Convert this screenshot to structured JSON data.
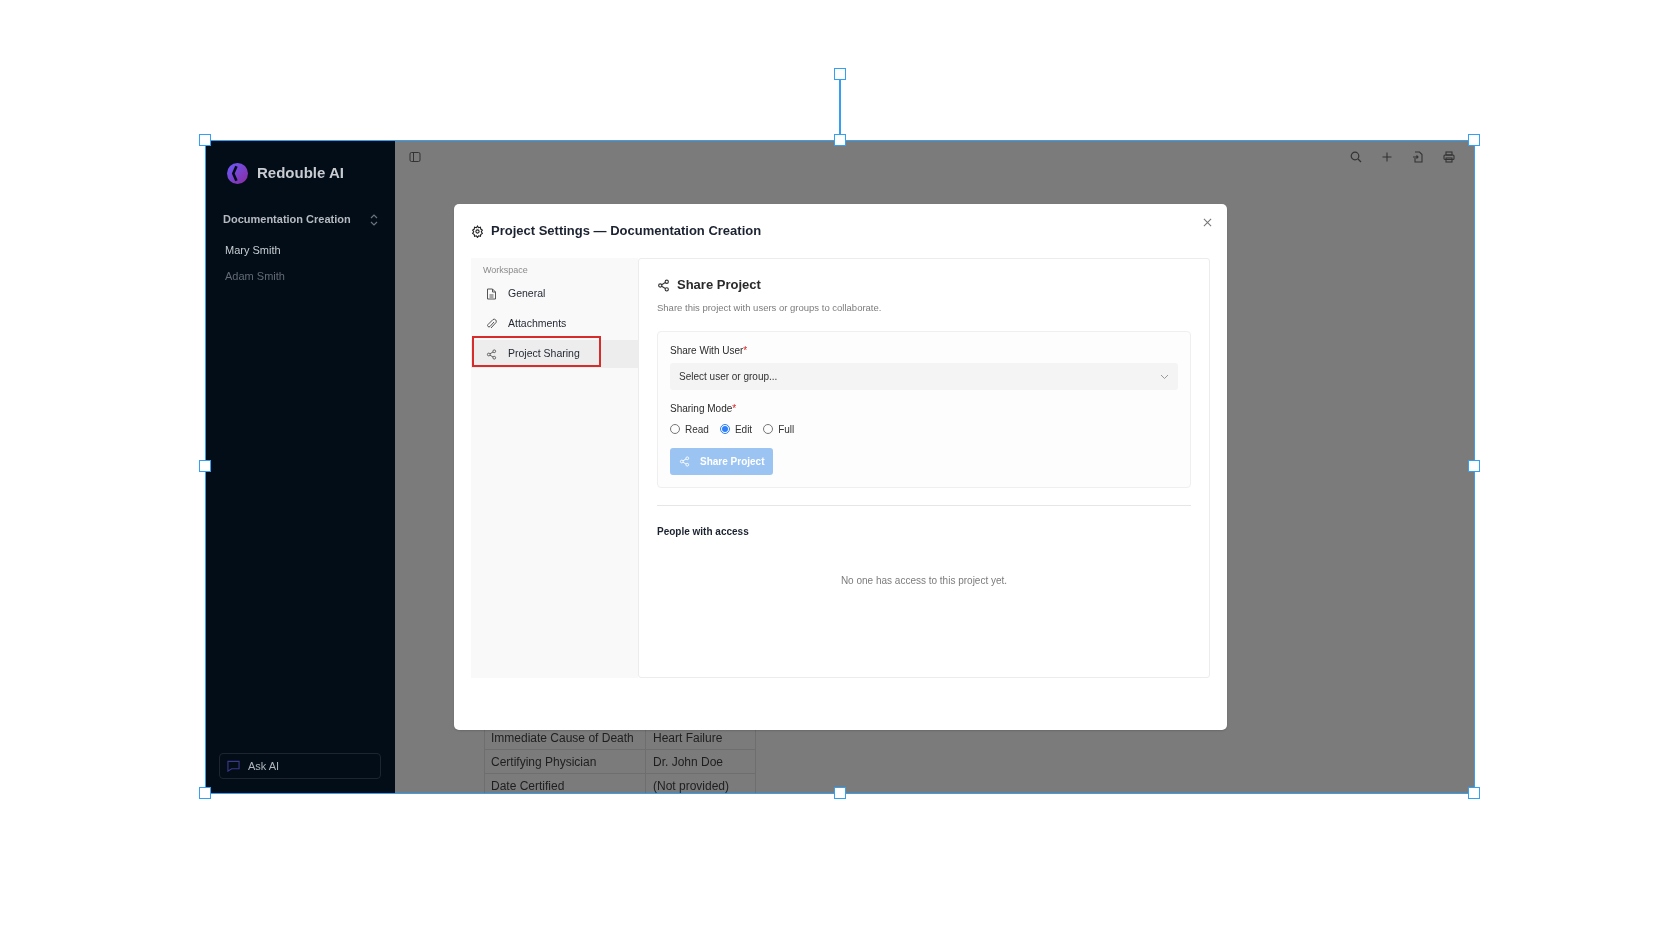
{
  "sidebar": {
    "brand": "Redouble AI",
    "project": "Documentation Creation",
    "items": [
      {
        "label": "Mary Smith",
        "selected": true
      },
      {
        "label": "Adam Smith",
        "selected": false
      }
    ],
    "ask_ai": "Ask AI"
  },
  "main": {
    "table": {
      "rows": [
        [
          "Immediate Cause of Death",
          "Heart Failure"
        ],
        [
          "Certifying Physician",
          "Dr. John Doe"
        ],
        [
          "Date Certified",
          "(Not provided)"
        ]
      ]
    }
  },
  "dialog": {
    "title": "Project Settings — Documentation Creation",
    "nav": {
      "section": "Workspace",
      "items": [
        {
          "label": "General",
          "selected": false,
          "highlighted": false
        },
        {
          "label": "Attachments",
          "selected": false,
          "highlighted": false
        },
        {
          "label": "Project Sharing",
          "selected": true,
          "highlighted": true
        }
      ]
    },
    "panel": {
      "heading": "Share Project",
      "description": "Share this project with users or groups to collaborate.",
      "user_field": {
        "label": "Share With User",
        "required_mark": "*",
        "placeholder": "Select user or group..."
      },
      "mode": {
        "label": "Sharing Mode",
        "required_mark": "*",
        "options": [
          {
            "label": "Read",
            "selected": false
          },
          {
            "label": "Edit",
            "selected": true
          },
          {
            "label": "Full",
            "selected": false
          }
        ]
      },
      "button": {
        "label": "Share Project",
        "disabled": true
      },
      "people": {
        "heading": "People with access",
        "empty": "No one has access to this project yet."
      }
    }
  }
}
